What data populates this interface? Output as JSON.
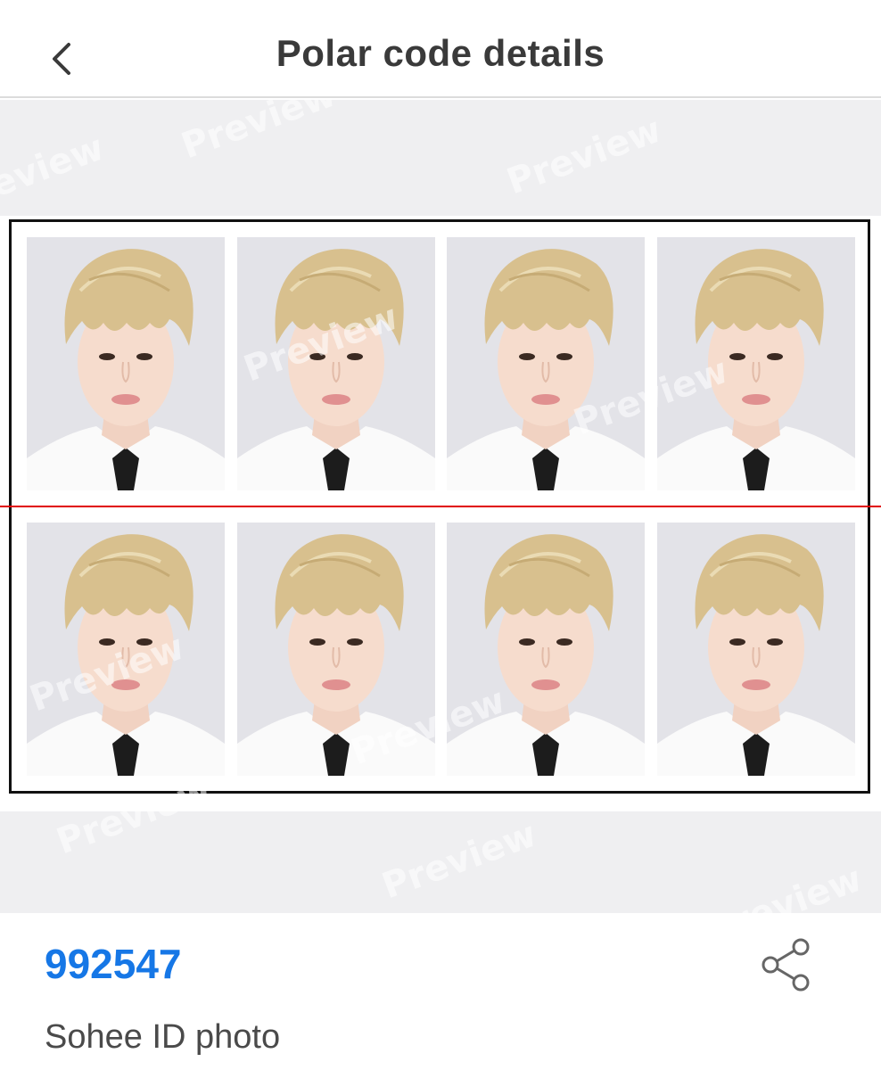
{
  "header": {
    "title": "Polar code details",
    "back_icon": "chevron-left-icon"
  },
  "preview": {
    "watermark_text": "Preview",
    "photo_rows": 2,
    "photo_cols": 4,
    "cut_line_color": "#e00000"
  },
  "info": {
    "code": "992547",
    "name": "Sohee ID photo",
    "share_icon": "share-icon"
  },
  "colors": {
    "accent": "#1677e6",
    "background": "#efeff1"
  }
}
